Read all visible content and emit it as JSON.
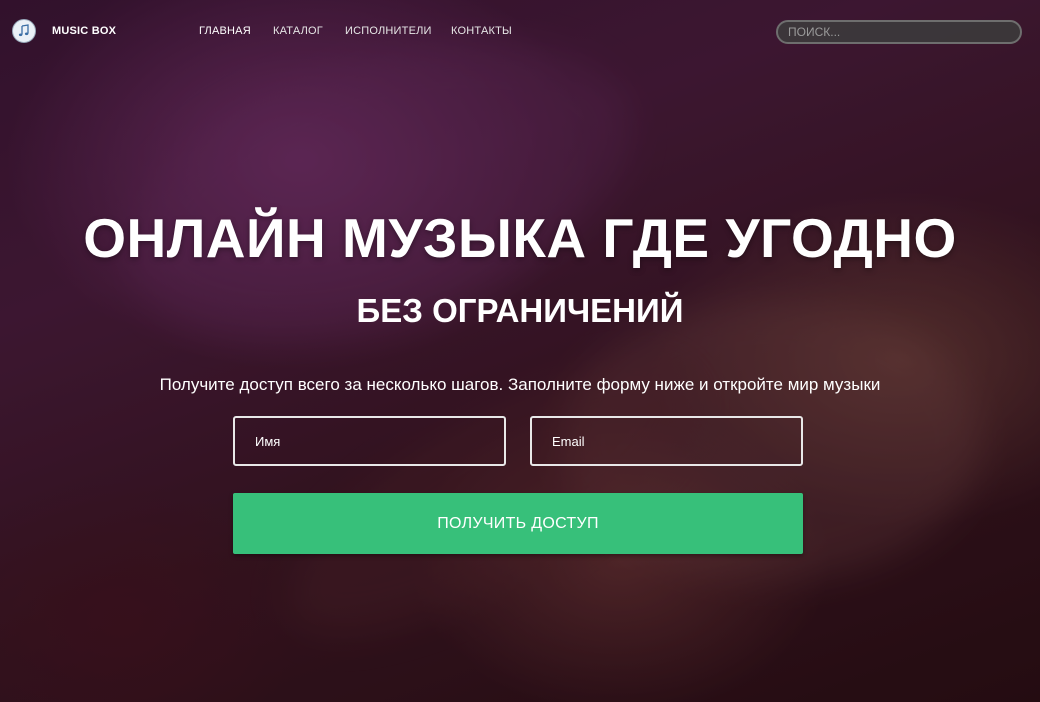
{
  "brand": {
    "name": "MUSIC BOX",
    "icon": "music-note-icon"
  },
  "nav": {
    "items": [
      {
        "label": "ГЛАВНАЯ",
        "active": true
      },
      {
        "label": "КАТАЛОГ",
        "active": false
      },
      {
        "label": "ИСПОЛНИТЕЛИ",
        "active": false
      },
      {
        "label": "КОНТАКТЫ",
        "active": false
      }
    ]
  },
  "search": {
    "placeholder": "ПОИСК...",
    "value": ""
  },
  "hero": {
    "headline": "ОНЛАЙН МУЗЫКА ГДЕ УГОДНО",
    "subheadline": "БЕЗ ОГРАНИЧЕНИЙ",
    "lead": "Получите доступ всего за несколько шагов. Заполните форму ниже и откройте мир музыки"
  },
  "form": {
    "name_placeholder": "Имя",
    "email_placeholder": "Email",
    "submit_label": "ПОЛУЧИТЬ ДОСТУП"
  },
  "colors": {
    "accent": "#37c07a",
    "text": "#ffffff"
  }
}
